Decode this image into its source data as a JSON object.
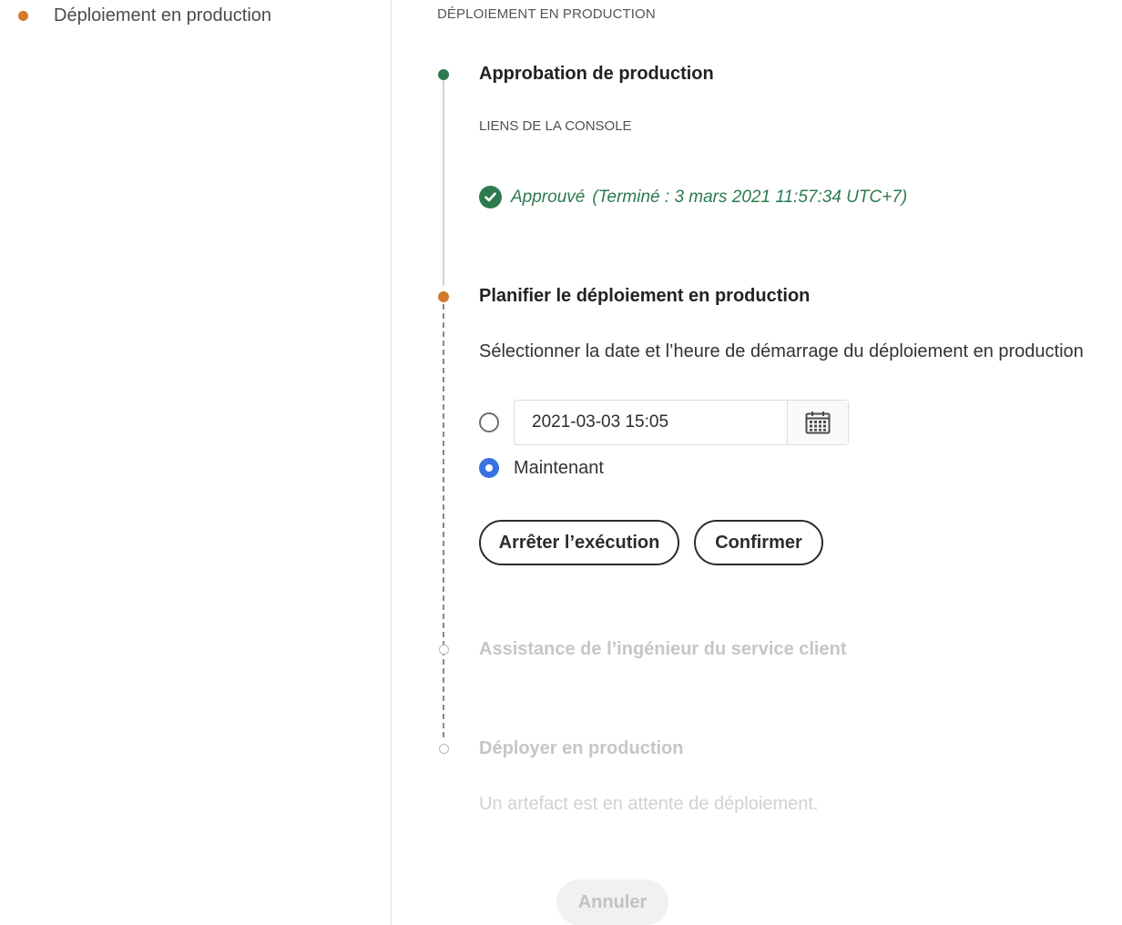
{
  "sidebar": {
    "items": [
      {
        "label": "Déploiement en production",
        "status_color": "#d07a2a"
      }
    ]
  },
  "main": {
    "section_heading": "DÉPLOIEMENT EN PRODUCTION",
    "steps": [
      {
        "title": "Approbation de production",
        "status": "done",
        "status_color": "#2d7a4f",
        "console_links": "LIENS DE LA CONSOLE",
        "approved_label": "Approuvé",
        "approved_detail": "(Terminé : 3 mars 2021 11:57:34 UTC+7)"
      },
      {
        "title": "Planifier le déploiement en production",
        "status": "in-progress",
        "status_color": "#d07a2a",
        "description": "Sélectionner la date et l’heure de démarrage du déploiement en production",
        "datetime_value": "2021-03-03 15:05",
        "now_label": "Maintenant",
        "selected_option": "now",
        "stop_button": "Arrêter l’exécution",
        "confirm_button": "Confirmer"
      },
      {
        "title": "Assistance de l’ingénieur du service client",
        "status": "pending"
      },
      {
        "title": "Déployer en production",
        "status": "pending",
        "description": "Un artefact est en attente de déploiement."
      }
    ],
    "cancel_button": "Annuler"
  },
  "colors": {
    "accent_blue": "#3873e0",
    "success_green": "#2d7a4f",
    "warning_orange": "#d07a2a"
  }
}
